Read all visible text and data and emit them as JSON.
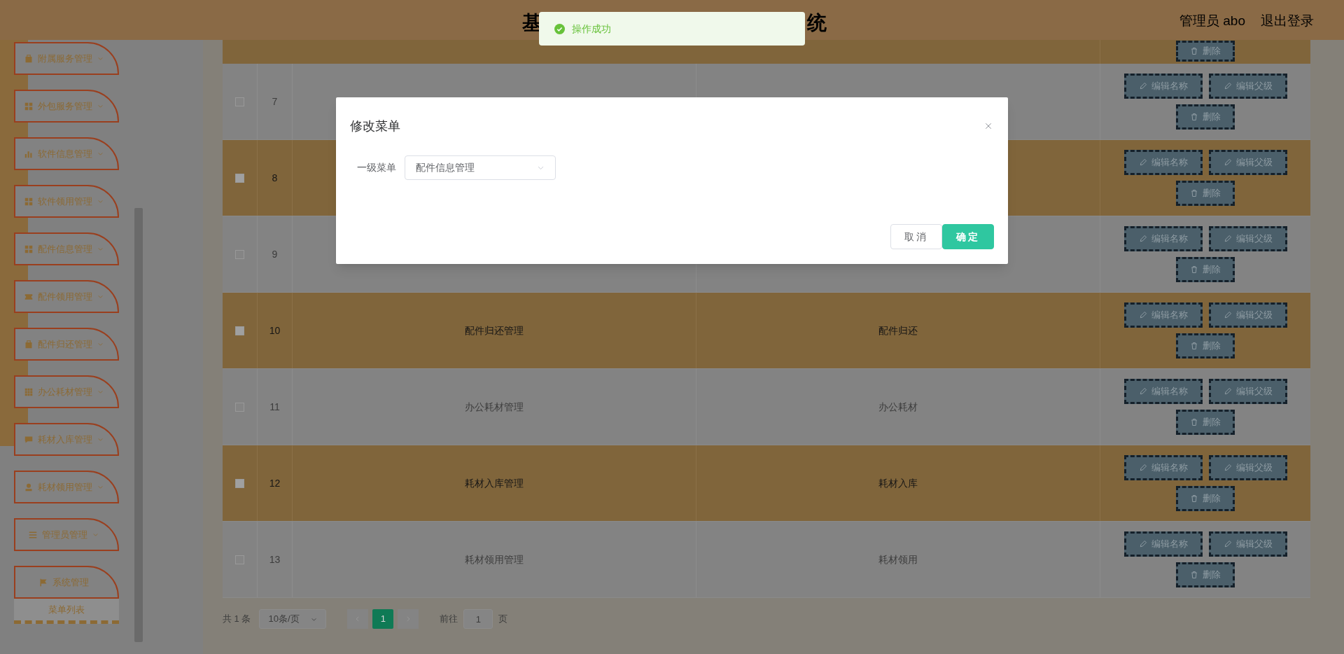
{
  "header": {
    "title_parts": [
      "基",
      "统"
    ],
    "user": "管理员 abo",
    "logout": "退出登录"
  },
  "toast": {
    "message": "操作成功"
  },
  "sidebar": {
    "items": [
      {
        "label": "附属服务管理"
      },
      {
        "label": "外包服务管理"
      },
      {
        "label": "软件信息管理"
      },
      {
        "label": "软件领用管理"
      },
      {
        "label": "配件信息管理"
      },
      {
        "label": "配件领用管理"
      },
      {
        "label": "配件归还管理"
      },
      {
        "label": "办公耗材管理"
      },
      {
        "label": "耗材入库管理"
      },
      {
        "label": "耗材领用管理"
      },
      {
        "label": "管理员管理"
      },
      {
        "label": "系统管理"
      }
    ],
    "footer": "菜单列表"
  },
  "table": {
    "partial_row": {
      "actions": [
        "删除"
      ]
    },
    "rows": [
      {
        "checked": false,
        "index": "7",
        "actions": [
          "编辑名称",
          "编辑父级",
          "删除"
        ]
      },
      {
        "checked": false,
        "index": "8",
        "actions": [
          "编辑名称",
          "编辑父级",
          "删除"
        ]
      },
      {
        "checked": false,
        "index": "9",
        "actions": [
          "编辑名称",
          "编辑父级",
          "删除"
        ]
      },
      {
        "checked": false,
        "index": "10",
        "menu_name": "配件归还管理",
        "label": "配件归还",
        "actions": [
          "编辑名称",
          "编辑父级",
          "删除"
        ]
      },
      {
        "checked": false,
        "index": "11",
        "menu_name": "办公耗材管理",
        "label": "办公耗材",
        "actions": [
          "编辑名称",
          "编辑父级",
          "删除"
        ]
      },
      {
        "checked": false,
        "index": "12",
        "menu_name": "耗材入库管理",
        "label": "耗材入库",
        "actions": [
          "编辑名称",
          "编辑父级",
          "删除"
        ]
      },
      {
        "checked": false,
        "index": "13",
        "menu_name": "耗材领用管理",
        "label": "耗材领用",
        "actions": [
          "编辑名称",
          "编辑父级",
          "删除"
        ]
      }
    ]
  },
  "pagination": {
    "total": "共 1 条",
    "page_size": "10条/页",
    "pages": [
      {
        "label": "1",
        "selected": true
      }
    ],
    "goto_label": "前往",
    "goto_value": "1",
    "goto_suffix": "页"
  },
  "dialog": {
    "title": "修改菜单",
    "field_label": "一级菜单",
    "field_value": "配件信息管理",
    "buttons": [
      {
        "label": "取消",
        "kind": "secondary"
      },
      {
        "label": "确定",
        "kind": "primary"
      }
    ]
  }
}
